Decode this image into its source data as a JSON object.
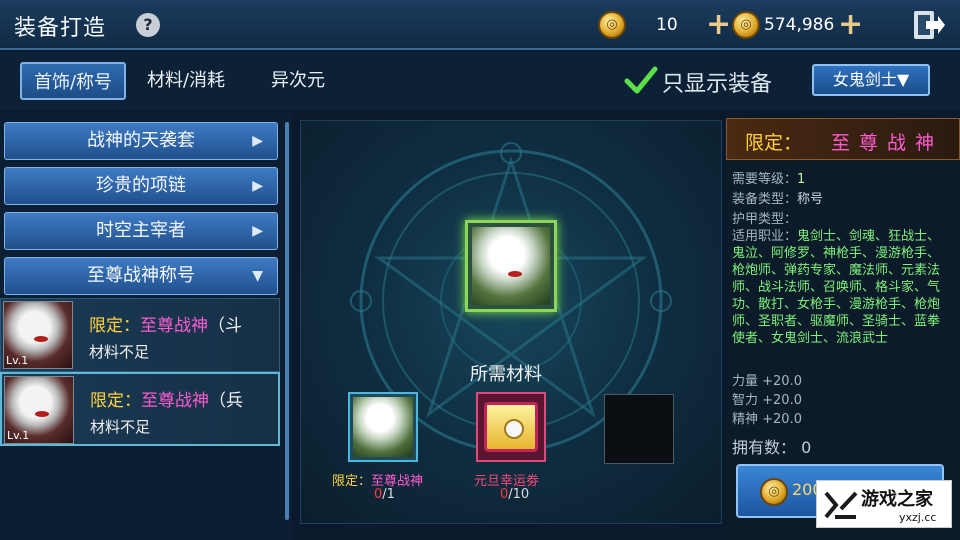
{
  "header": {
    "title": "装备打造",
    "help_label": "?",
    "currency_1": "10",
    "currency_2": "574,986"
  },
  "tabs": [
    {
      "label": "首饰/称号",
      "active": true
    },
    {
      "label": "材料/消耗",
      "active": false
    },
    {
      "label": "异次元",
      "active": false
    }
  ],
  "filter": {
    "show_only_label": "只显示装备",
    "class_select": "女鬼剑士▼"
  },
  "categories": [
    {
      "label": "战神的天袭套",
      "arrow": "▶"
    },
    {
      "label": "珍贵的项链",
      "arrow": "▶"
    },
    {
      "label": "时空主宰者",
      "arrow": "▶"
    },
    {
      "label": "至尊战神称号",
      "arrow": "▼"
    }
  ],
  "items": [
    {
      "limited": "限定：",
      "name": "至尊战神",
      "suffix": "（斗",
      "status": "材料不足",
      "level": "Lv.1"
    },
    {
      "limited": "限定：",
      "name": "至尊战神",
      "suffix": "（兵",
      "status": "材料不足",
      "level": "Lv.1"
    }
  ],
  "center": {
    "required_label": "所需材料",
    "materials": [
      {
        "name_limited": "限定：",
        "name": "至尊战神",
        "have": "0",
        "need": "/1",
        "name_color": "#ff5bd0"
      },
      {
        "name_limited": "",
        "name": "元旦幸运劵",
        "have": "0",
        "need": "/10",
        "name_color": "#ff4b7a"
      }
    ]
  },
  "detail": {
    "limited": "限定：",
    "name": "至尊战",
    "name_cut": "神",
    "level_label": "需要等级：",
    "level_value": "1",
    "type_label": "装备类型：",
    "type_value": "称号",
    "armor_label": "护甲类型：",
    "job_label": "适用职业：",
    "job_value": "鬼剑士、剑魂、狂战士、鬼泣、阿修罗、神枪手、漫游枪手、枪炮师、弹药专家、魔法师、元素法师、战斗法师、召唤师、格斗家、气功、散打、女枪手、漫游枪手、枪炮师、圣职者、驱魔师、圣骑士、蓝拳使者、女鬼剑士、流浪武士",
    "stats": [
      "力量 +20.0",
      "智力 +20.0",
      "精神 +20.0"
    ],
    "owned": "拥有数： 0",
    "craft_cost": "200"
  },
  "watermark": {
    "name": "游戏之家",
    "url": "yxzj.cc"
  },
  "colors": {
    "limited": "#ffd23c",
    "item_name": "#ff5bd0",
    "job": "#7ef07a",
    "insufficient": "#ff3b3b"
  }
}
